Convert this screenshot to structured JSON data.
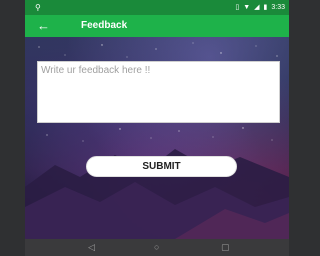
{
  "status_bar": {
    "time": "3:33",
    "left_icon": "notification-icon",
    "right_icons": [
      "vibrate-icon",
      "wifi-icon",
      "signal-icon",
      "battery-icon"
    ]
  },
  "app_bar": {
    "title": "Feedback",
    "back_icon": "arrow-left-icon",
    "color": "#1eb24a"
  },
  "form": {
    "placeholder": "Write ur feedback here !!",
    "value": "",
    "submit_label": "SUBMIT"
  },
  "nav_bar": {
    "items": [
      "back-icon",
      "home-icon",
      "recents-icon"
    ]
  }
}
